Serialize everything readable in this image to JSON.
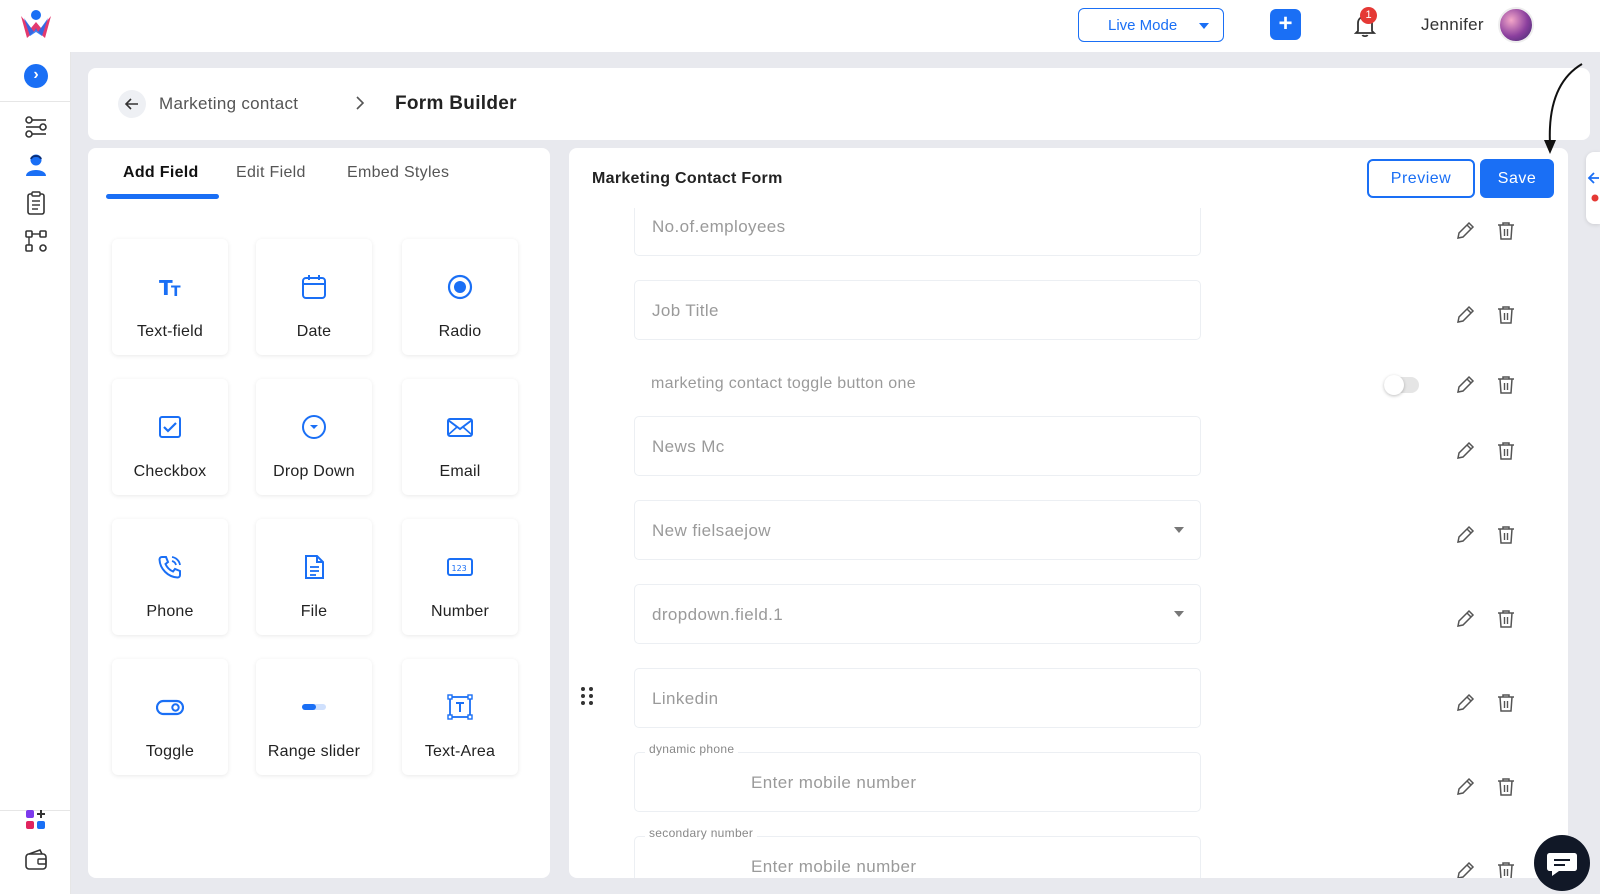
{
  "topbar": {
    "mode_label": "Live Mode",
    "notification_count": "1",
    "user_name": "Jennifer"
  },
  "breadcrumb": {
    "parent": "Marketing contact",
    "current": "Form Builder"
  },
  "left_panel": {
    "tabs": [
      {
        "label": "Add Field",
        "active": true
      },
      {
        "label": "Edit Field",
        "active": false
      },
      {
        "label": "Embed Styles",
        "active": false
      }
    ],
    "fields": [
      {
        "label": "Text-field",
        "icon": "text-icon"
      },
      {
        "label": "Date",
        "icon": "calendar-icon"
      },
      {
        "label": "Radio",
        "icon": "radio-icon"
      },
      {
        "label": "Checkbox",
        "icon": "checkbox-icon"
      },
      {
        "label": "Drop Down",
        "icon": "dropdown-icon"
      },
      {
        "label": "Email",
        "icon": "email-icon"
      },
      {
        "label": "Phone",
        "icon": "phone-icon"
      },
      {
        "label": "File",
        "icon": "file-icon"
      },
      {
        "label": "Number",
        "icon": "number-icon"
      },
      {
        "label": "Toggle",
        "icon": "toggle-icon"
      },
      {
        "label": "Range slider",
        "icon": "slider-icon"
      },
      {
        "label": "Text-Area",
        "icon": "textarea-icon"
      }
    ]
  },
  "form": {
    "title": "Marketing Contact Form",
    "preview_label": "Preview",
    "save_label": "Save",
    "rows": [
      {
        "type": "input",
        "placeholder": "No.of.employees"
      },
      {
        "type": "input",
        "placeholder": "Job Title"
      },
      {
        "type": "toggle",
        "placeholder": "marketing contact toggle button one"
      },
      {
        "type": "input",
        "placeholder": "News Mc"
      },
      {
        "type": "dropdown",
        "placeholder": "New fielsaejow"
      },
      {
        "type": "dropdown",
        "placeholder": "dropdown.field.1"
      },
      {
        "type": "input",
        "placeholder": "Linkedin"
      },
      {
        "type": "phone",
        "label": "dynamic phone",
        "placeholder": "Enter mobile number"
      },
      {
        "type": "phone",
        "label": "secondary number",
        "placeholder": "Enter mobile number"
      }
    ]
  },
  "colors": {
    "accent": "#1a6ff5",
    "badge": "#e53935"
  }
}
